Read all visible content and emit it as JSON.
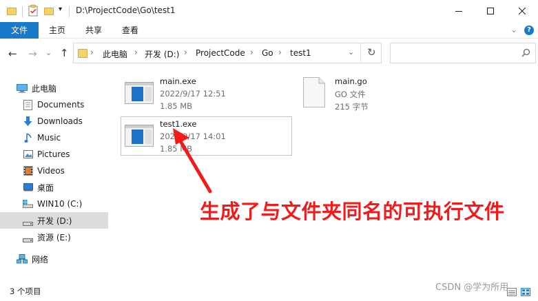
{
  "window": {
    "path_title": "D:\\ProjectCode\\Go\\test1",
    "minimize": "—",
    "maximize": "☐",
    "close": "✕"
  },
  "ribbon": {
    "tabs": [
      "文件",
      "主页",
      "共享",
      "查看"
    ],
    "expand": "⌄",
    "help": "?"
  },
  "nav": {
    "back": "←",
    "forward": "→",
    "history": "⌄",
    "up": "↑",
    "breadcrumb": [
      "此电脑",
      "开发 (D:)",
      "ProjectCode",
      "Go",
      "test1"
    ],
    "breadcrumb_sep": "›",
    "address_dropdown": "⌄",
    "refresh": "↻"
  },
  "sidebar": {
    "items": [
      {
        "label": "此电脑",
        "icon": "computer-icon"
      },
      {
        "label": "Documents",
        "icon": "documents-icon"
      },
      {
        "label": "Downloads",
        "icon": "downloads-icon"
      },
      {
        "label": "Music",
        "icon": "music-icon"
      },
      {
        "label": "Pictures",
        "icon": "pictures-icon"
      },
      {
        "label": "Videos",
        "icon": "videos-icon"
      },
      {
        "label": "桌面",
        "icon": "desktop-icon"
      },
      {
        "label": "WIN10 (C:)",
        "icon": "drive-c-icon"
      },
      {
        "label": "开发 (D:)",
        "icon": "drive-d-icon",
        "selected": true
      },
      {
        "label": "资源 (E:)",
        "icon": "drive-e-icon"
      },
      {
        "label": "网络",
        "icon": "network-icon"
      }
    ]
  },
  "files": [
    {
      "name": "main.exe",
      "line2": "2022/9/17 12:51",
      "line3": "1.85 MB",
      "icon": "exe-icon"
    },
    {
      "name": "main.go",
      "line2": "GO 文件",
      "line3": "215 字节",
      "icon": "file-icon"
    },
    {
      "name": "test1.exe",
      "line2": "2022/9/17 14:01",
      "line3": "1.85 MB",
      "icon": "exe-icon"
    }
  ],
  "status": {
    "count": "3 个项目"
  },
  "annotation": {
    "text": "生成了与文件夹同名的可执行文件",
    "color": "#f21a1a"
  },
  "watermark": "CSDN @学为所用",
  "colors": {
    "accent": "#1979ca",
    "selection": "#dcdcdc",
    "hover_border": "#99d1ef"
  }
}
